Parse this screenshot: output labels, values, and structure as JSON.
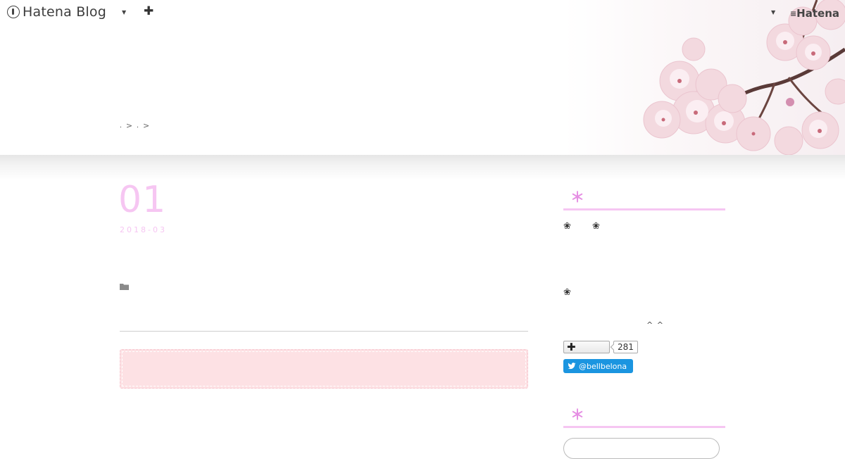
{
  "topbar": {
    "logo_text": "Hatena Blog",
    "right_brand": "Hatena",
    "icons": [
      "hatena-logo-icon",
      "chevron-down-icon",
      "plus-icon",
      "chevron-down-icon",
      "hatena-brand-icon"
    ]
  },
  "header": {
    "breadcrumb": [
      ">",
      ">"
    ]
  },
  "entry": {
    "day": "01",
    "year_month": "2018-03",
    "category_icon": "folder-icon"
  },
  "sidebar": {
    "section_mark": "＊",
    "flower_glyph": "❀",
    "caret_text": "^ ^",
    "follow": {
      "icon": "plus-icon",
      "count": "281"
    },
    "twitter": {
      "handle": "@bellbelona",
      "icon": "twitter-bird-icon"
    }
  },
  "colors": {
    "accent_pink": "#f6c6f2",
    "pink_box": "#fde1e4",
    "twitter_blue": "#1b95e0"
  }
}
